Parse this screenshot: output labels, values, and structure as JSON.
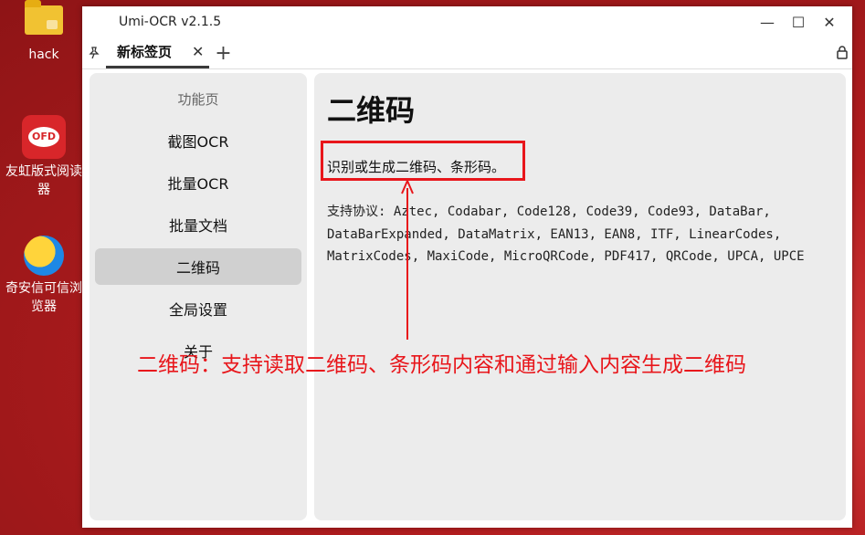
{
  "desktop": {
    "icons": [
      {
        "name": "hack",
        "label": "hack"
      },
      {
        "name": "pdf-reader",
        "label": "友虹版式阅读器"
      },
      {
        "name": "qianxin-browser",
        "label": "奇安信可信浏览器"
      }
    ],
    "pdf_badge": "OFD"
  },
  "window": {
    "title": "Umi-OCR v2.1.5",
    "controls": {
      "minimize": "—",
      "maximize": "☐",
      "close": "✕"
    }
  },
  "tabs": {
    "pin": "📌",
    "active_label": "新标签页",
    "close": "✕",
    "add": "+",
    "lock": "🔒"
  },
  "sidebar": {
    "heading": "功能页",
    "items": [
      {
        "label": "截图OCR",
        "active": false
      },
      {
        "label": "批量OCR",
        "active": false
      },
      {
        "label": "批量文档",
        "active": false
      },
      {
        "label": "二维码",
        "active": true
      },
      {
        "label": "全局设置",
        "active": false
      },
      {
        "label": "关于",
        "active": false
      }
    ]
  },
  "main": {
    "title": "二维码",
    "description": "识别或生成二维码、条形码。",
    "protocols": "支持协议: Aztec, Codabar, Code128, Code39, Code93, DataBar, DataBarExpanded, DataMatrix, EAN13, EAN8, ITF, LinearCodes, MatrixCodes, MaxiCode, MicroQRCode, PDF417, QRCode, UPCA, UPCE"
  },
  "annotation": {
    "text": "二维码：支持读取二维码、条形码内容和通过输入内容生成二维码",
    "color": "#e8161b"
  }
}
